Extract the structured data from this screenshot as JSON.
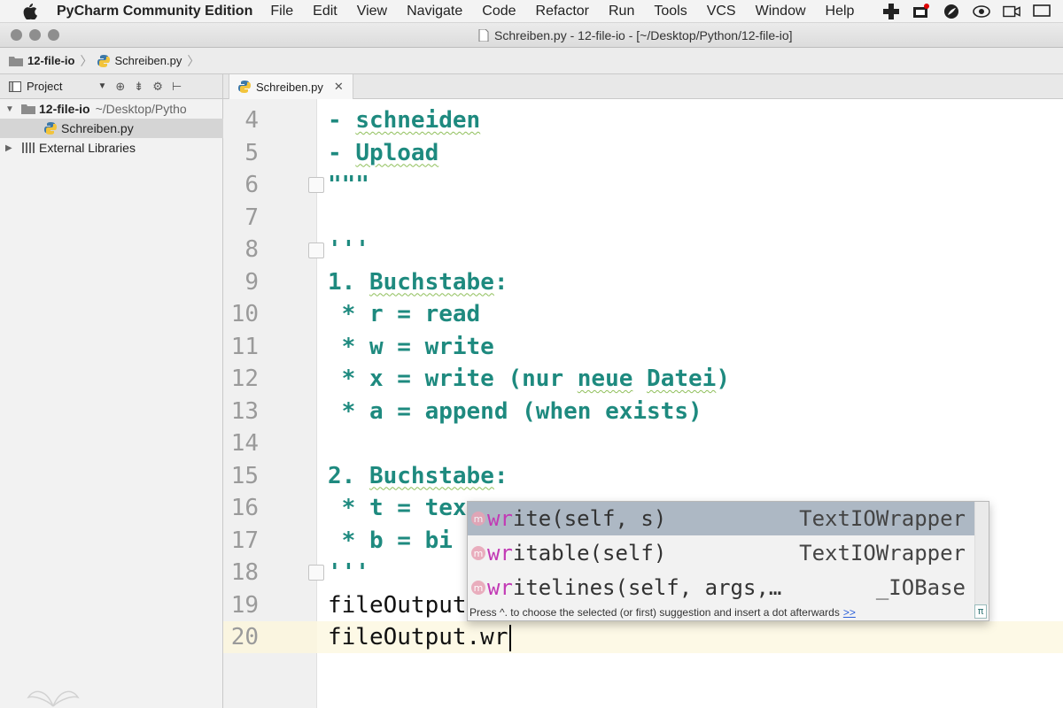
{
  "menubar": {
    "app_name": "PyCharm Community Edition",
    "items": [
      "File",
      "Edit",
      "View",
      "Navigate",
      "Code",
      "Refactor",
      "Run",
      "Tools",
      "VCS",
      "Window",
      "Help"
    ]
  },
  "window": {
    "title": "Schreiben.py - 12-file-io - [~/Desktop/Python/12-file-io]"
  },
  "breadcrumb": {
    "folder": "12-file-io",
    "file": "Schreiben.py"
  },
  "project_panel": {
    "title": "Project",
    "tree": [
      {
        "label": "12-file-io",
        "hint": "~/Desktop/Pytho",
        "type": "folder",
        "expanded": true
      },
      {
        "label": "Schreiben.py",
        "hint": "",
        "type": "python-file",
        "selected": true
      },
      {
        "label": "External Libraries",
        "hint": "",
        "type": "libraries",
        "expanded": false
      }
    ]
  },
  "editor": {
    "tab_label": "Schreiben.py",
    "lines": [
      {
        "num": "4",
        "text": "- schneiden",
        "style": "doc"
      },
      {
        "num": "5",
        "text": "- Upload",
        "style": "doc"
      },
      {
        "num": "6",
        "text": "\"\"\"",
        "style": "doc"
      },
      {
        "num": "7",
        "text": "",
        "style": "doc"
      },
      {
        "num": "8",
        "text": "'''",
        "style": "doc"
      },
      {
        "num": "9",
        "text": "1. Buchstabe:",
        "style": "doc"
      },
      {
        "num": "10",
        "text": " * r = read",
        "style": "doc"
      },
      {
        "num": "11",
        "text": " * w = write",
        "style": "doc"
      },
      {
        "num": "12",
        "text": " * x = write (nur neue Datei)",
        "style": "doc"
      },
      {
        "num": "13",
        "text": " * a = append (when exists)",
        "style": "doc"
      },
      {
        "num": "14",
        "text": "",
        "style": "doc"
      },
      {
        "num": "15",
        "text": "2. Buchstabe:",
        "style": "doc"
      },
      {
        "num": "16",
        "text": " * t = tex",
        "style": "doc"
      },
      {
        "num": "17",
        "text": " * b = bi",
        "style": "doc"
      },
      {
        "num": "18",
        "text": "'''",
        "style": "doc"
      },
      {
        "num": "19",
        "text": "fileOutput",
        "style": "plain"
      },
      {
        "num": "20",
        "text": "fileOutput.wr",
        "style": "plain"
      }
    ]
  },
  "completion": {
    "items": [
      {
        "match": "wr",
        "rest": "ite(self, s)",
        "type": "TextIOWrapper",
        "selected": true
      },
      {
        "match": "wr",
        "rest": "itable(self)",
        "type": "TextIOWrapper",
        "selected": false
      },
      {
        "match": "wr",
        "rest": "itelines(self, args,…",
        "type": "_IOBase",
        "selected": false
      }
    ],
    "hint": "Press ^. to choose the selected (or first) suggestion and insert a dot afterwards",
    "hint_link": ">>",
    "pi_label": "π",
    "method_badge": "m"
  },
  "colors": {
    "docstring": "#1e8a7f",
    "match_highlight": "#c23bb5",
    "selection": "#adb8c4"
  }
}
